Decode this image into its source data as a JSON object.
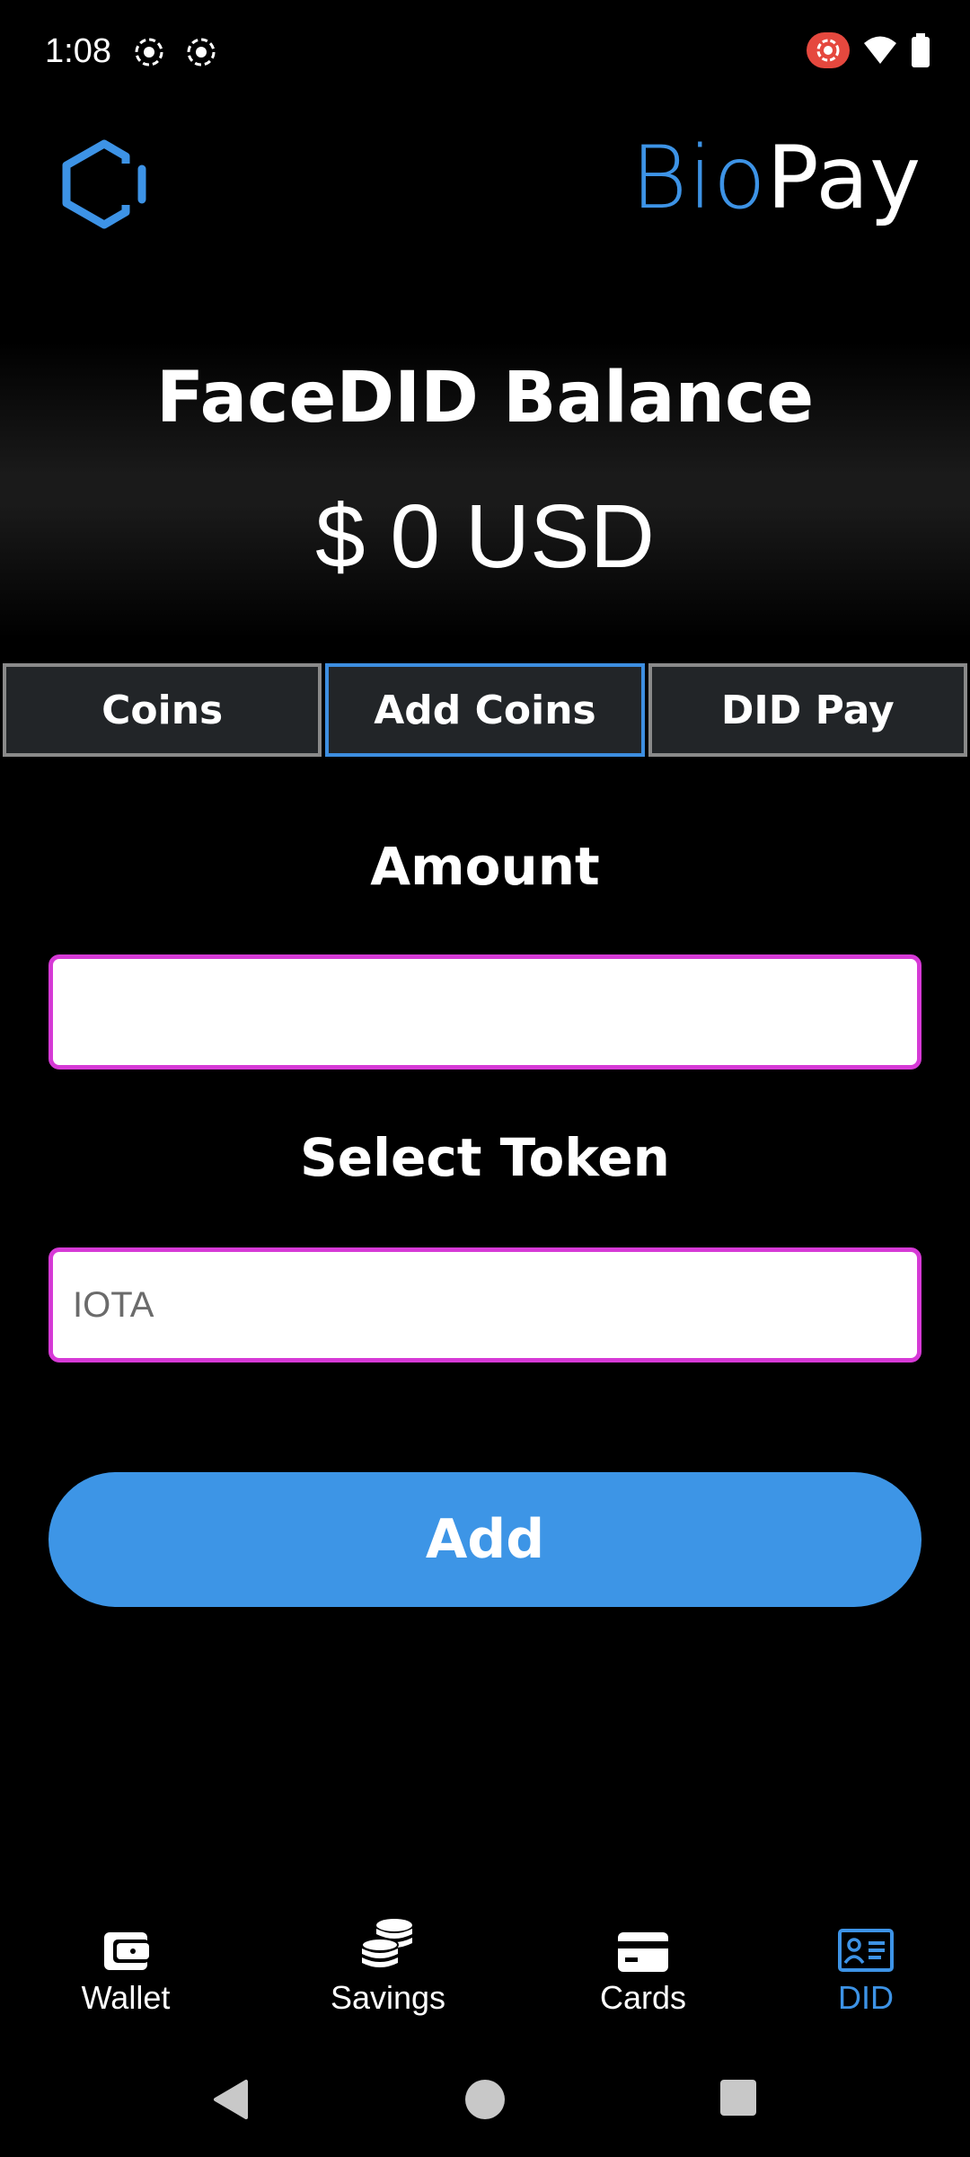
{
  "status_bar": {
    "time": "1:08",
    "icons": [
      "screen-record-icon",
      "screen-record-icon",
      "cast-recording-icon",
      "wifi-icon",
      "battery-icon"
    ]
  },
  "header": {
    "brand_part1": "Bio",
    "brand_part2": "Pay",
    "logo_icon": "hexagon-logo-icon"
  },
  "balance": {
    "title": "FaceDID Balance",
    "amount": "$ 0 USD"
  },
  "tabs": [
    {
      "label": "Coins",
      "active": false
    },
    {
      "label": "Add Coins",
      "active": true
    },
    {
      "label": "DID Pay",
      "active": false
    }
  ],
  "form": {
    "amount_label": "Amount",
    "amount_value": "",
    "token_label": "Select Token",
    "token_placeholder": "IOTA",
    "add_label": "Add"
  },
  "bottom_nav": [
    {
      "label": "Wallet",
      "icon": "wallet-icon",
      "active": false
    },
    {
      "label": "Savings",
      "icon": "coins-stack-icon",
      "active": false
    },
    {
      "label": "Cards",
      "icon": "credit-card-icon",
      "active": false
    },
    {
      "label": "DID",
      "icon": "id-card-icon",
      "active": true
    }
  ],
  "colors": {
    "accent": "#3d93e6",
    "field_border": "#d63ad6",
    "tab_border": "#8a8a8a",
    "tab_bg": "#222528",
    "background": "#000000"
  }
}
